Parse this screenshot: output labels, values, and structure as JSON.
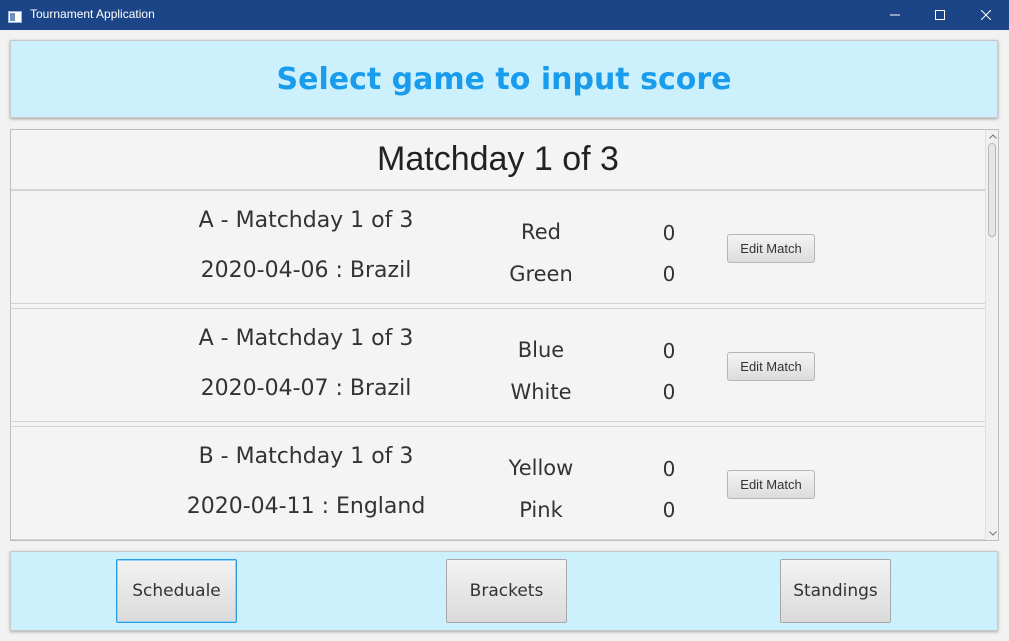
{
  "window": {
    "title": "Tournament Application",
    "accent_color": "#1c4587"
  },
  "header": {
    "title": "Select game to input score",
    "title_color": "#1a9cec",
    "background": "#cdf0fd"
  },
  "schedule": {
    "matchday_heading": "Matchday 1 of 3",
    "matches": [
      {
        "title": "A - Matchday 1 of 3",
        "date_location": "2020-04-06 : Brazil",
        "team1": "Red",
        "team2": "Green",
        "score1": "0",
        "score2": "0",
        "button_label": "Edit Match"
      },
      {
        "title": "A - Matchday 1 of 3",
        "date_location": "2020-04-07 : Brazil",
        "team1": "Blue",
        "team2": "White",
        "score1": "0",
        "score2": "0",
        "button_label": "Edit Match"
      },
      {
        "title": "B - Matchday 1 of 3",
        "date_location": "2020-04-11 : England",
        "team1": "Yellow",
        "team2": "Pink",
        "score1": "0",
        "score2": "0",
        "button_label": "Edit Match"
      }
    ]
  },
  "footer": {
    "buttons": [
      {
        "label": "Scheduale",
        "focused": true
      },
      {
        "label": "Brackets",
        "focused": false
      },
      {
        "label": "Standings",
        "focused": false
      }
    ]
  }
}
